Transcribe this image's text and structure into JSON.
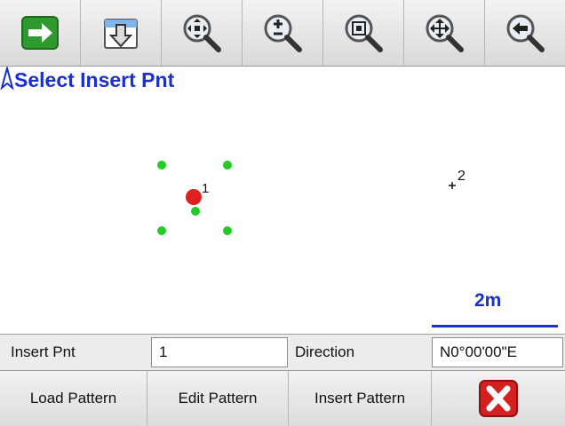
{
  "toolbar": {
    "buttons": [
      {
        "icon": "arrow-right-icon"
      },
      {
        "icon": "download-icon"
      },
      {
        "icon": "zoom-extent-icon"
      },
      {
        "icon": "zoom-in-out-icon"
      },
      {
        "icon": "zoom-window-icon"
      },
      {
        "icon": "pan-icon"
      },
      {
        "icon": "back-icon"
      }
    ]
  },
  "map": {
    "title": "Select Insert Pnt",
    "point1_label": "1",
    "point2_label": "2",
    "scale_label": "2m",
    "colors": {
      "title": "#1a2fd0",
      "selected_point": "#e02020",
      "pattern_points": "#22cc22"
    }
  },
  "fields": {
    "insert_pnt_label": "Insert Pnt",
    "insert_pnt_value": "1",
    "direction_label": "Direction",
    "direction_value": "N0°00'00\"E"
  },
  "buttons": {
    "load_pattern": "Load Pattern",
    "edit_pattern": "Edit Pattern",
    "insert_pattern": "Insert Pattern"
  }
}
